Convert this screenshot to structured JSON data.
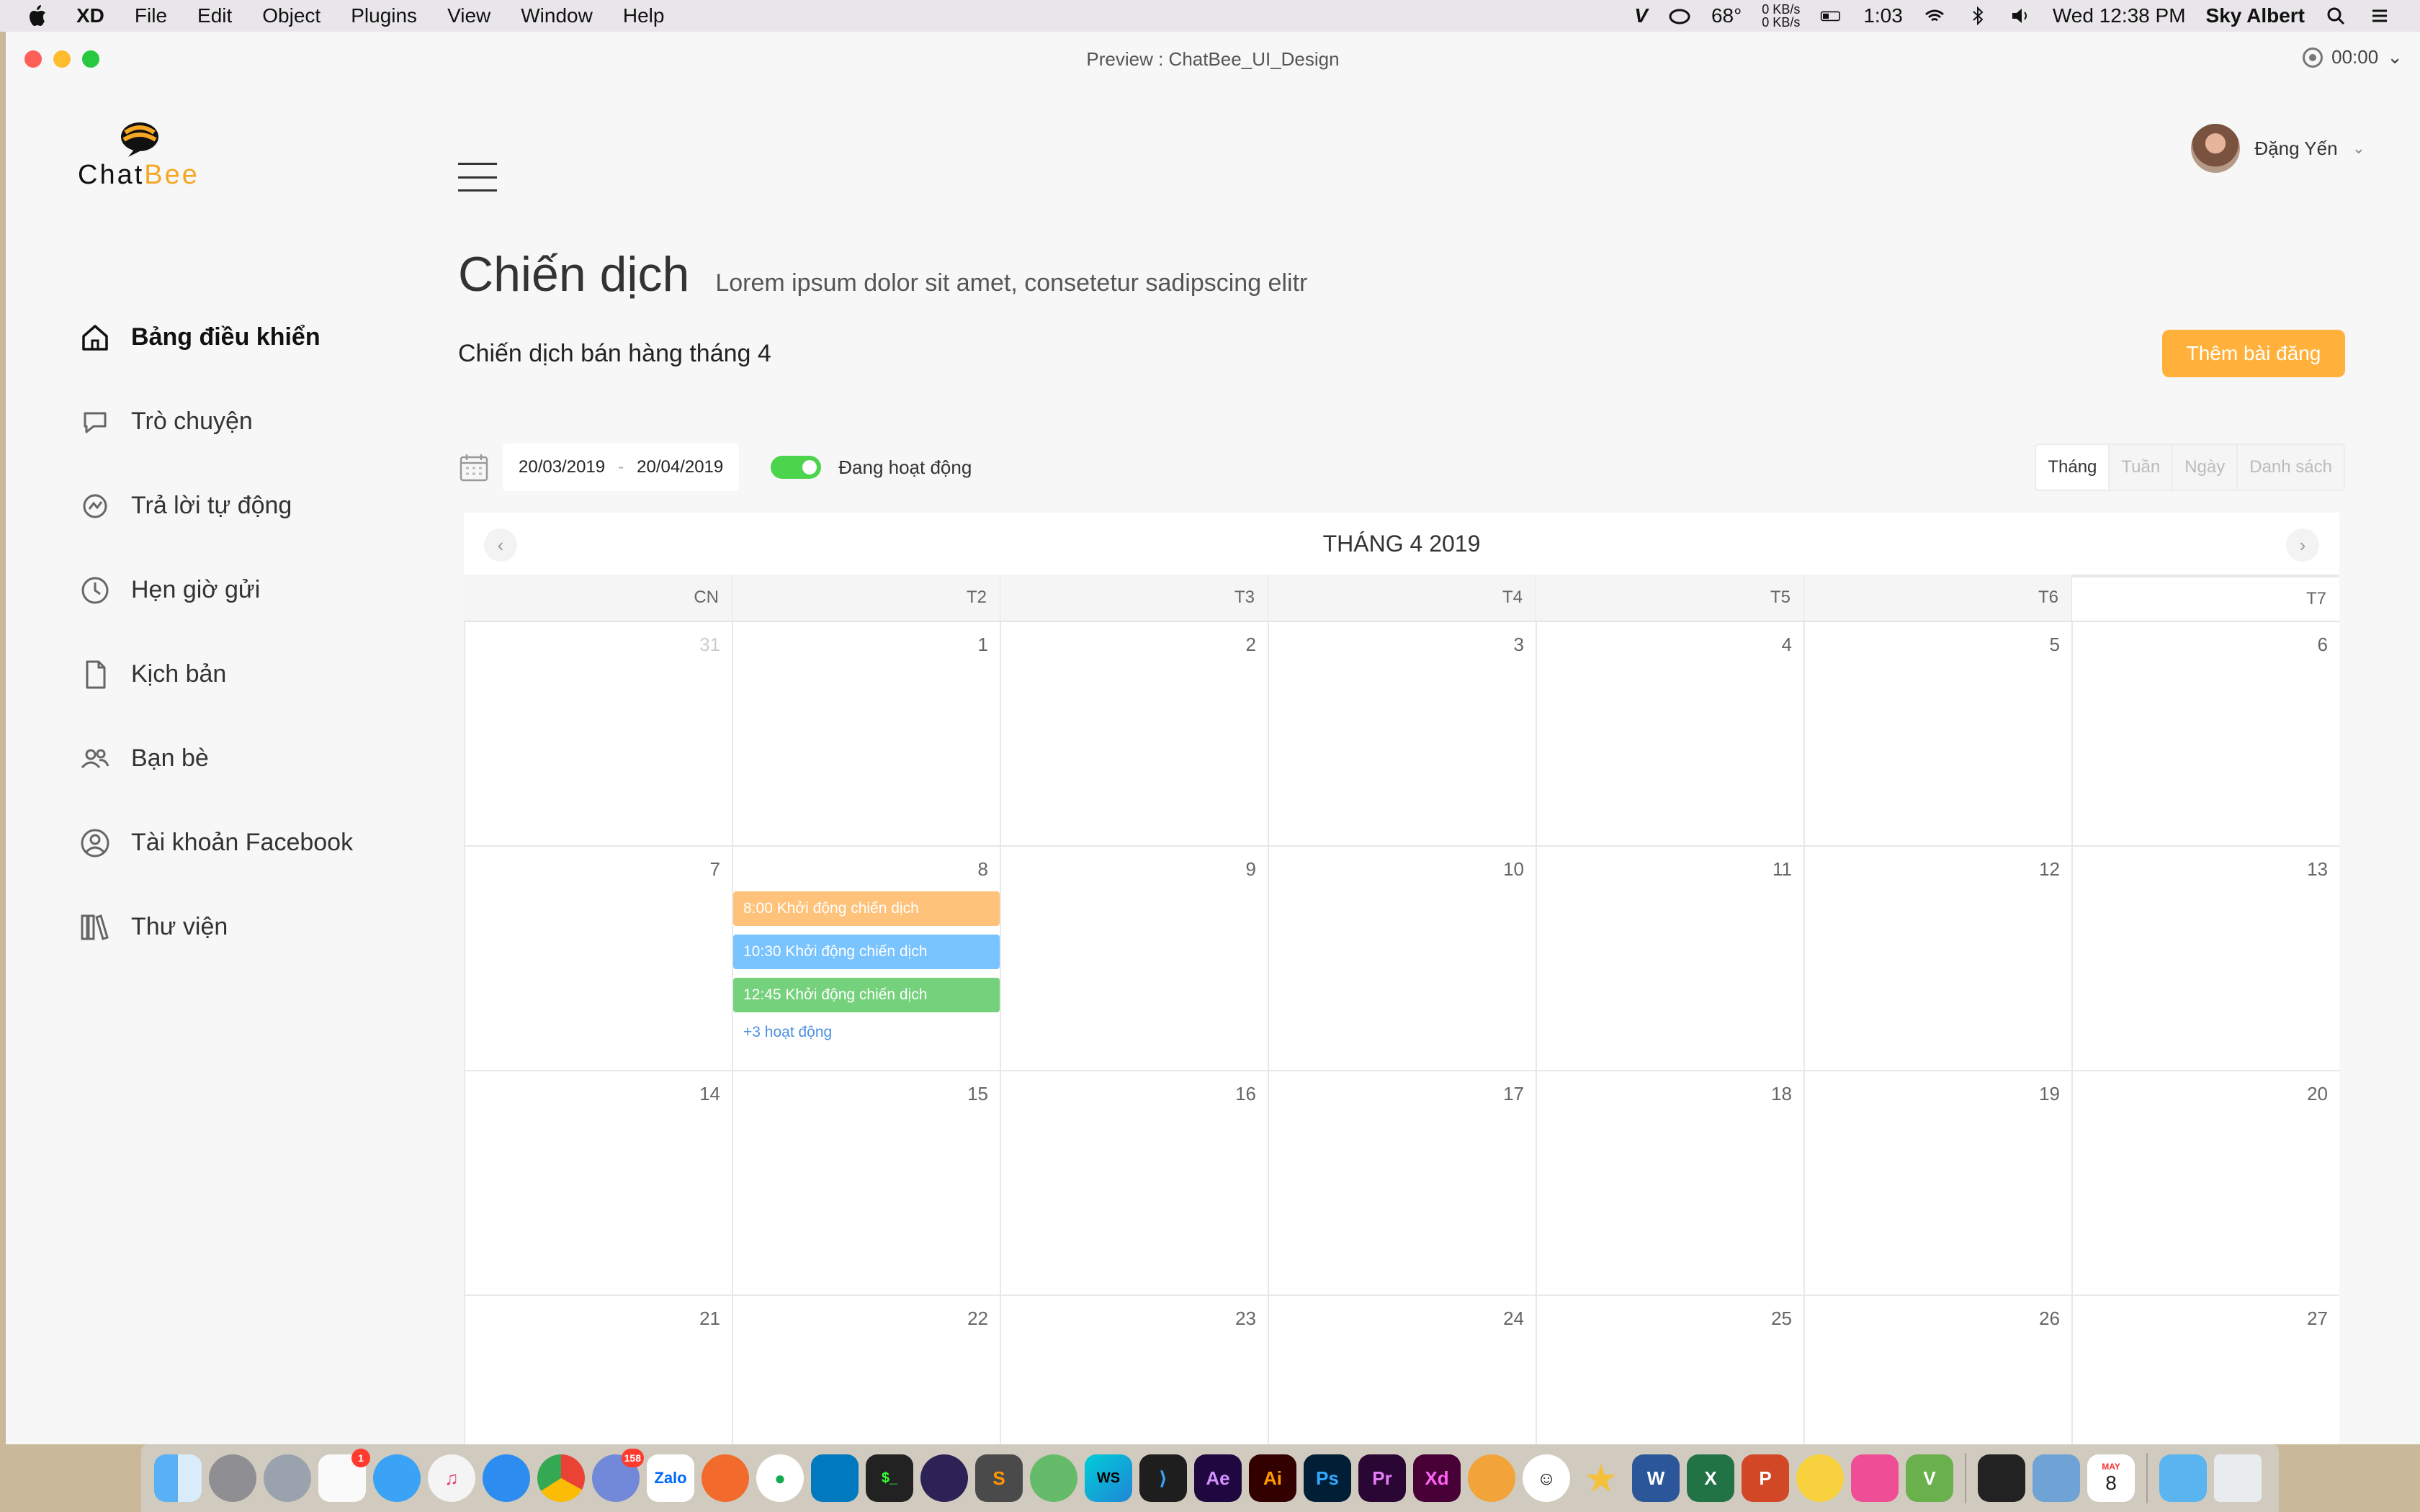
{
  "menubar": {
    "app_name": "XD",
    "menus": [
      "File",
      "Edit",
      "Object",
      "Plugins",
      "View",
      "Window",
      "Help"
    ],
    "temperature": "68°",
    "net_up": "0 KB/s",
    "net_down": "0 KB/s",
    "battery_time": "1:03",
    "clock": "Wed 12:38 PM",
    "user": "Sky Albert"
  },
  "window": {
    "title": "Preview : ChatBee_UI_Design",
    "timer": "00:00"
  },
  "brand": {
    "part1": "Chat",
    "part2": "Bee",
    "accent_color": "#f6a623"
  },
  "sidebar": {
    "items": [
      {
        "label": "Bảng điều khiển",
        "icon": "home-icon",
        "active": true
      },
      {
        "label": "Trò chuyện",
        "icon": "chat-icon"
      },
      {
        "label": "Trả lời tự động",
        "icon": "auto-reply-icon"
      },
      {
        "label": "Hẹn giờ gửi",
        "icon": "clock-icon"
      },
      {
        "label": "Kịch bản",
        "icon": "document-icon"
      },
      {
        "label": "Bạn bè",
        "icon": "friends-icon"
      },
      {
        "label": "Tài khoản Facebook",
        "icon": "account-icon"
      },
      {
        "label": "Thư viện",
        "icon": "library-icon"
      }
    ]
  },
  "header": {
    "user_name": "Đặng Yến"
  },
  "page": {
    "title": "Chiến dịch",
    "subtitle": "Lorem ipsum dolor sit amet, consetetur sadipscing elitr",
    "campaign_name": "Chiến dịch bán hàng tháng 4",
    "add_button": "Thêm bài đăng",
    "date_from": "20/03/2019",
    "date_sep": "-",
    "date_to": "20/04/2019",
    "status_label": "Đang hoạt động",
    "status_color": "#4cd44c",
    "view_tabs": [
      "Tháng",
      "Tuần",
      "Ngày",
      "Danh sách"
    ],
    "active_view": "Tháng"
  },
  "calendar": {
    "month_label": "THÁNG 4 2019",
    "weekdays": [
      "CN",
      "T2",
      "T3",
      "T4",
      "T5",
      "T6",
      "T7"
    ],
    "weeks": [
      [
        "31",
        "1",
        "2",
        "3",
        "4",
        "5",
        "6"
      ],
      [
        "7",
        "8",
        "9",
        "10",
        "11",
        "12",
        "13"
      ],
      [
        "14",
        "15",
        "16",
        "17",
        "18",
        "19",
        "20"
      ],
      [
        "21",
        "22",
        "23",
        "24",
        "25",
        "26",
        "27"
      ]
    ],
    "events_day_8": [
      {
        "label": "8:00 Khởi động chiến dịch",
        "color": "#ffc27a"
      },
      {
        "label": "10:30 Khởi động chiến dịch",
        "color": "#79c3ff"
      },
      {
        "label": "12:45 Khởi động chiến dịch",
        "color": "#75d17b"
      }
    ],
    "more_label": "+3 hoạt động"
  },
  "dock": {
    "badges": {
      "reminders": "1",
      "discord": "158"
    },
    "zalo_label": "Zalo",
    "calendar_month": "MAY",
    "calendar_day": "8"
  }
}
